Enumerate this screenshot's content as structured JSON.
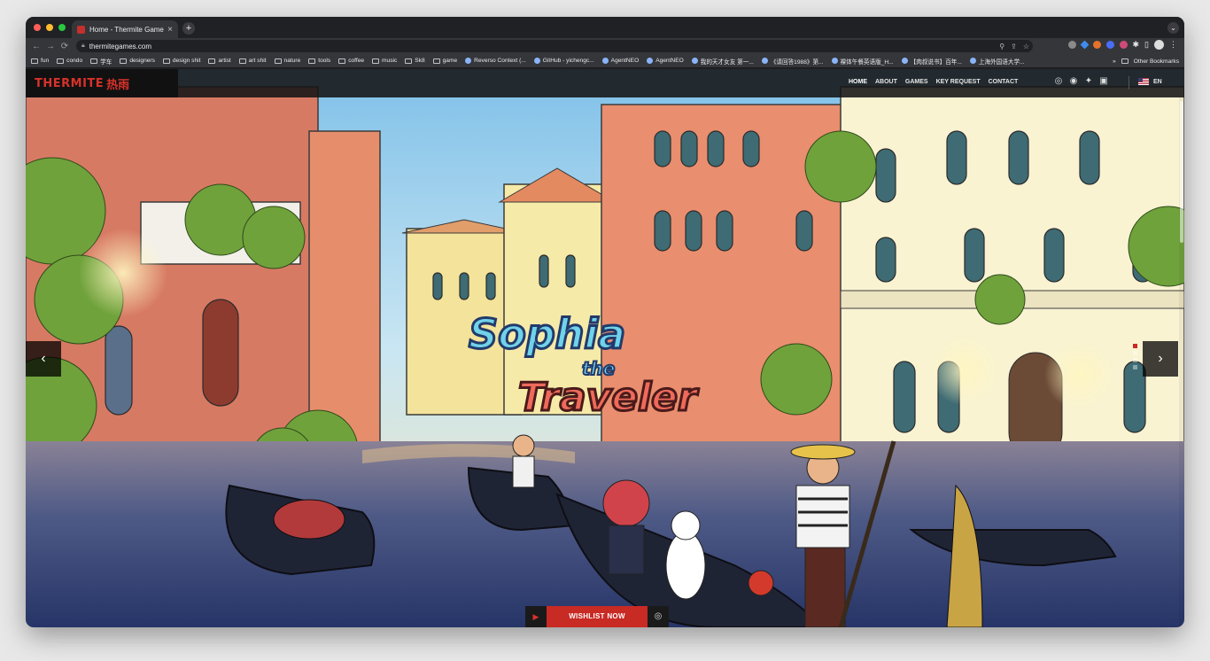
{
  "browser": {
    "tab_title": "Home - Thermite Games",
    "tab_close": "×",
    "new_tab": "+",
    "url": "thermitegames.com",
    "nav": {
      "back": "←",
      "forward": "→",
      "reload": "⟳"
    },
    "bookmarks": [
      {
        "label": "fun",
        "type": "folder"
      },
      {
        "label": "condo",
        "type": "folder"
      },
      {
        "label": "学车",
        "type": "folder"
      },
      {
        "label": "designers",
        "type": "folder"
      },
      {
        "label": "design shit",
        "type": "folder"
      },
      {
        "label": "artist",
        "type": "folder"
      },
      {
        "label": "art shit",
        "type": "folder"
      },
      {
        "label": "nature",
        "type": "folder"
      },
      {
        "label": "tools",
        "type": "folder"
      },
      {
        "label": "coffee",
        "type": "folder"
      },
      {
        "label": "music",
        "type": "folder"
      },
      {
        "label": "Sk8",
        "type": "folder"
      },
      {
        "label": "game",
        "type": "folder"
      },
      {
        "label": "Reverso Context (...",
        "type": "site"
      },
      {
        "label": "GitHub - yichengc...",
        "type": "site"
      },
      {
        "label": "AgentNEO",
        "type": "site"
      },
      {
        "label": "AgentNEO",
        "type": "site"
      },
      {
        "label": "我的天才女友 第一...",
        "type": "site"
      },
      {
        "label": "《请回答1988》第...",
        "type": "site"
      },
      {
        "label": "裸体午餐英语版_H...",
        "type": "site"
      },
      {
        "label": "【肉叔说书】百年...",
        "type": "site"
      },
      {
        "label": "上海外国语大学...",
        "type": "site"
      }
    ],
    "bookmarks_more": "»",
    "other_bookmarks": "Other Bookmarks"
  },
  "site": {
    "logo": "THERMITE",
    "logo_cn": "热雨",
    "nav": [
      "HOME",
      "ABOUT",
      "GAMES",
      "KEY REQUEST",
      "CONTACT"
    ],
    "language": "EN",
    "hero": {
      "title_line1": "Sophia",
      "title_line2": "the",
      "title_line3": "Traveler",
      "cta_label": "WISHLIST NOW",
      "prev": "‹",
      "next": "›"
    }
  }
}
